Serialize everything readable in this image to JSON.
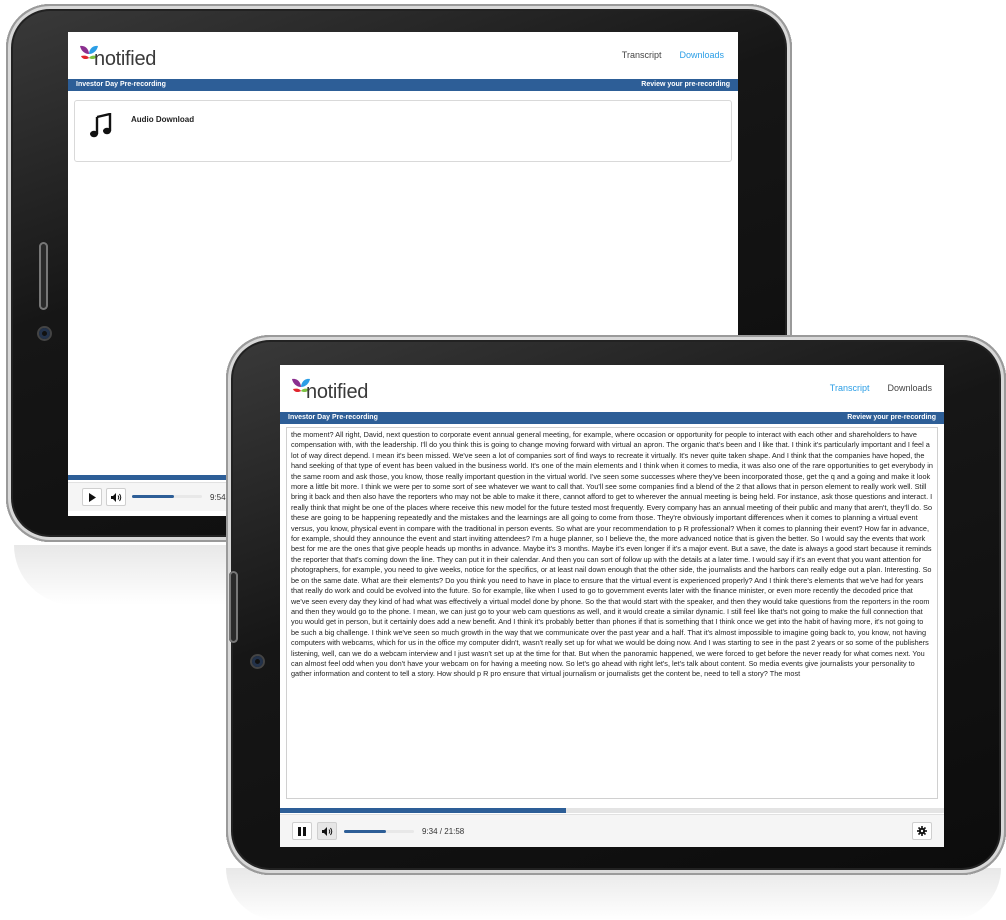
{
  "back": {
    "brand": "notified",
    "nav": [
      {
        "label": "Transcript",
        "active": false
      },
      {
        "label": "Downloads",
        "active": true
      }
    ],
    "band_left": "Investor Day Pre-recording",
    "band_right": "Review your pre-recording",
    "download_label": "Audio Download",
    "time": "9:54",
    "progress": 0.45,
    "volume": 0.6
  },
  "front": {
    "brand": "notified",
    "nav": [
      {
        "label": "Transcript",
        "active": true
      },
      {
        "label": "Downloads",
        "active": false
      }
    ],
    "band_left": "Investor Day Pre-recording",
    "band_right": "Review your pre-recording",
    "transcript": "the moment? All right, David, next question to corporate event annual general meeting, for example, where occasion or opportunity for people to interact with each other and shareholders to have compensation with, with the leadership. I'll do you think this is going to change moving forward with virtual an apron. The organic that's been and I like that. I think it's particularly important and I feel a lot of way direct depend. I mean it's been missed. We've seen a lot of companies sort of find ways to recreate it virtually. It's never quite taken shape. And I think that the companies have hoped, the hand seeking of that type of event has been valued in the business world. It's one of the main elements and I think when it comes to media, it was also one of the rare opportunities to get everybody in the same room and ask those, you know, those really important question in the virtual world. I've seen some successes where they've been incorporated those, get the q and a going and make it look more a little bit more. I think we were per to some sort of see whatever we want to call that. You'll see some companies find a blend of the 2 that allows that in person element to really work well. Still bring it back and then also have the reporters who may not be able to make it there, cannot afford to get to wherever the annual meeting is being held. For instance, ask those questions and interact. I really think that might be one of the places where receive this new model for the future tested most frequently. Every company has an annual meeting of their public and many that aren't, they'll do. So these are going to be happening repeatedly and the mistakes and the learnings are all going to come from those. They're obviously important differences when it comes to planning a virtual event versus, you know, physical event in compare with the traditional in person events. So what are your recommendation to p R professional? When it comes to planning their event? How far in advance, for example, should they announce the event and start inviting attendees? I'm a huge planner, so I believe the, the more advanced notice that is given the better. So I would say the events that work best for me are the ones that give people heads up months in advance. Maybe it's 3 months. Maybe it's even longer if it's a major event. But a save, the date is always a good start because it reminds the reporter that that's coming down the line. They can put it in their calendar. And then you can sort of follow up with the details at a later time. I would say if it's an event that you want attention for photographers, for example, you need to give weeks, notice for the specifics, or at least nail down enough that the other side, the journalists and the harbors can really edge out a plan. Interesting. So be on the same date. What are their elements? Do you think you need to have in place to ensure that the virtual event is experienced properly? And I think there's elements that we've had for years that really do work and could be evolved into the future. So for example, like when I used to go to government events later with the finance minister, or even more recently the decoded price that we've seen every day they kind of had what was effectively a virtual model done by phone. So the that would start with the speaker, and then they would take questions from the reporters in the room and then they would go to the phone. I mean, we can just go to your web cam questions as well, and it would create a similar dynamic. I still feel like that's not going to make the full connection that you would get in person, but it certainly does add a new benefit. And I think it's probably better than phones if that is something that I think once we get into the habit of having more, it's not going to be such a big challenge. I think we've seen so much growth in the way that we communicate over the past year and a half. That it's almost impossible to imagine going back to, you know, not having computers with webcams, which for us in the office my computer didn't, wasn't really set up for what we would be doing now. And I was starting to see in the past 2 years or so some of the publishers listening, well, can we do a webcam interview and I just wasn't set up at the time for that. But when the panoramic happened, we were forced to get before the never ready for what comes next. You can almost feel odd when you don't have your webcam on for having a meeting now. So let's go ahead with right let's, let's talk about content. So media events give journalists your personality to gather information and content to tell a story. How should p R pro ensure that virtual journalism or journalists get the content be, need to tell a story? The most",
    "time": "9:34 / 21:58",
    "progress": 0.43,
    "volume": 0.6
  }
}
